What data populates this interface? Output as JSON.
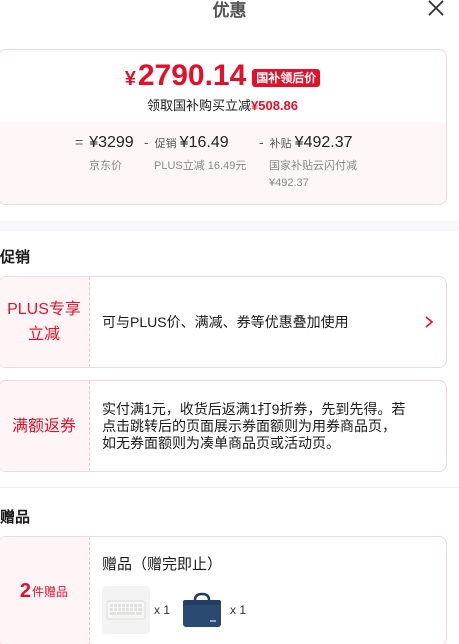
{
  "header": {
    "title": "优惠",
    "close_icon": "close-icon"
  },
  "price": {
    "currency": "¥",
    "final": "2790.14",
    "tag": "国补领后价",
    "savings_prefix": "领取国补购买立减",
    "savings_amount": "¥508.86"
  },
  "breakdown": {
    "items": [
      {
        "operator": "=",
        "label": "",
        "value": "¥3299",
        "sub": "京东价"
      },
      {
        "operator": "-",
        "label": "促销",
        "value": "¥16.49",
        "sub": "PLUS立减 16.49元"
      },
      {
        "operator": "-",
        "label": "补贴",
        "value": "¥492.37",
        "sub": "国家补贴云闪付减",
        "sub2": "¥492.37"
      }
    ]
  },
  "promotions": {
    "title": "促销",
    "items": [
      {
        "tag": "PLUS专享立减",
        "desc": "可与PLUS价、满减、券等优惠叠加使用",
        "has_arrow": true
      },
      {
        "tag": "满额返券",
        "desc": "实付满1元，收货后返满1打9折券，先到先得。若点击跳转后的页面展示券面额则为用券商品页，如无券面额则为凑单商品页或活动页。",
        "has_arrow": false
      }
    ]
  },
  "gifts": {
    "title": "赠品",
    "count": "2",
    "count_label": "件赠品",
    "heading": "赠品（赠完即止）",
    "items": [
      {
        "name": "keyboard-thumbnail",
        "qty": "x 1"
      },
      {
        "name": "bag-thumbnail",
        "qty": "x 1"
      }
    ]
  },
  "colors": {
    "accent": "#e4102a",
    "card_border": "#f6d6da",
    "tag_bg": "#fff5f6"
  }
}
